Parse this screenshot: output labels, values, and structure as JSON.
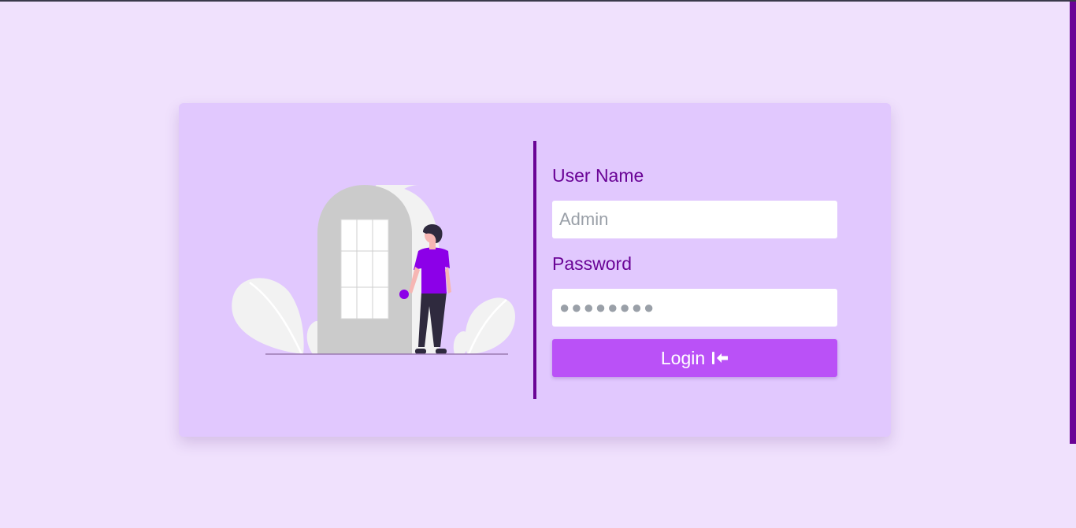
{
  "login_form": {
    "username_label": "User Name",
    "username_placeholder": "Admin",
    "password_label": "Password",
    "password_placeholder": "●●●●●●●●",
    "login_button_label": "Login",
    "login_icon": "sign-in-icon"
  },
  "colors": {
    "page_background": "#f0e1fd",
    "card_background": "#e1c8fe",
    "accent": "#6a0496",
    "button": "#ba51f7",
    "label_text": "#6a0496"
  }
}
